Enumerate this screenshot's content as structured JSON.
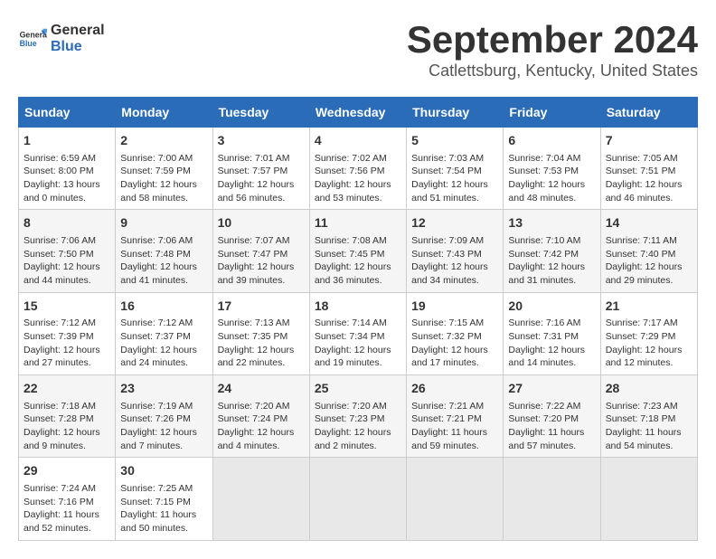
{
  "logo": {
    "text_line1": "General",
    "text_line2": "Blue"
  },
  "header": {
    "month_year": "September 2024",
    "location": "Catlettsburg, Kentucky, United States"
  },
  "calendar": {
    "headers": [
      "Sunday",
      "Monday",
      "Tuesday",
      "Wednesday",
      "Thursday",
      "Friday",
      "Saturday"
    ],
    "rows": [
      [
        {
          "day": "1",
          "info": "Sunrise: 6:59 AM\nSunset: 8:00 PM\nDaylight: 13 hours\nand 0 minutes."
        },
        {
          "day": "2",
          "info": "Sunrise: 7:00 AM\nSunset: 7:59 PM\nDaylight: 12 hours\nand 58 minutes."
        },
        {
          "day": "3",
          "info": "Sunrise: 7:01 AM\nSunset: 7:57 PM\nDaylight: 12 hours\nand 56 minutes."
        },
        {
          "day": "4",
          "info": "Sunrise: 7:02 AM\nSunset: 7:56 PM\nDaylight: 12 hours\nand 53 minutes."
        },
        {
          "day": "5",
          "info": "Sunrise: 7:03 AM\nSunset: 7:54 PM\nDaylight: 12 hours\nand 51 minutes."
        },
        {
          "day": "6",
          "info": "Sunrise: 7:04 AM\nSunset: 7:53 PM\nDaylight: 12 hours\nand 48 minutes."
        },
        {
          "day": "7",
          "info": "Sunrise: 7:05 AM\nSunset: 7:51 PM\nDaylight: 12 hours\nand 46 minutes."
        }
      ],
      [
        {
          "day": "8",
          "info": "Sunrise: 7:06 AM\nSunset: 7:50 PM\nDaylight: 12 hours\nand 44 minutes."
        },
        {
          "day": "9",
          "info": "Sunrise: 7:06 AM\nSunset: 7:48 PM\nDaylight: 12 hours\nand 41 minutes."
        },
        {
          "day": "10",
          "info": "Sunrise: 7:07 AM\nSunset: 7:47 PM\nDaylight: 12 hours\nand 39 minutes."
        },
        {
          "day": "11",
          "info": "Sunrise: 7:08 AM\nSunset: 7:45 PM\nDaylight: 12 hours\nand 36 minutes."
        },
        {
          "day": "12",
          "info": "Sunrise: 7:09 AM\nSunset: 7:43 PM\nDaylight: 12 hours\nand 34 minutes."
        },
        {
          "day": "13",
          "info": "Sunrise: 7:10 AM\nSunset: 7:42 PM\nDaylight: 12 hours\nand 31 minutes."
        },
        {
          "day": "14",
          "info": "Sunrise: 7:11 AM\nSunset: 7:40 PM\nDaylight: 12 hours\nand 29 minutes."
        }
      ],
      [
        {
          "day": "15",
          "info": "Sunrise: 7:12 AM\nSunset: 7:39 PM\nDaylight: 12 hours\nand 27 minutes."
        },
        {
          "day": "16",
          "info": "Sunrise: 7:12 AM\nSunset: 7:37 PM\nDaylight: 12 hours\nand 24 minutes."
        },
        {
          "day": "17",
          "info": "Sunrise: 7:13 AM\nSunset: 7:35 PM\nDaylight: 12 hours\nand 22 minutes."
        },
        {
          "day": "18",
          "info": "Sunrise: 7:14 AM\nSunset: 7:34 PM\nDaylight: 12 hours\nand 19 minutes."
        },
        {
          "day": "19",
          "info": "Sunrise: 7:15 AM\nSunset: 7:32 PM\nDaylight: 12 hours\nand 17 minutes."
        },
        {
          "day": "20",
          "info": "Sunrise: 7:16 AM\nSunset: 7:31 PM\nDaylight: 12 hours\nand 14 minutes."
        },
        {
          "day": "21",
          "info": "Sunrise: 7:17 AM\nSunset: 7:29 PM\nDaylight: 12 hours\nand 12 minutes."
        }
      ],
      [
        {
          "day": "22",
          "info": "Sunrise: 7:18 AM\nSunset: 7:28 PM\nDaylight: 12 hours\nand 9 minutes."
        },
        {
          "day": "23",
          "info": "Sunrise: 7:19 AM\nSunset: 7:26 PM\nDaylight: 12 hours\nand 7 minutes."
        },
        {
          "day": "24",
          "info": "Sunrise: 7:20 AM\nSunset: 7:24 PM\nDaylight: 12 hours\nand 4 minutes."
        },
        {
          "day": "25",
          "info": "Sunrise: 7:20 AM\nSunset: 7:23 PM\nDaylight: 12 hours\nand 2 minutes."
        },
        {
          "day": "26",
          "info": "Sunrise: 7:21 AM\nSunset: 7:21 PM\nDaylight: 11 hours\nand 59 minutes."
        },
        {
          "day": "27",
          "info": "Sunrise: 7:22 AM\nSunset: 7:20 PM\nDaylight: 11 hours\nand 57 minutes."
        },
        {
          "day": "28",
          "info": "Sunrise: 7:23 AM\nSunset: 7:18 PM\nDaylight: 11 hours\nand 54 minutes."
        }
      ],
      [
        {
          "day": "29",
          "info": "Sunrise: 7:24 AM\nSunset: 7:16 PM\nDaylight: 11 hours\nand 52 minutes."
        },
        {
          "day": "30",
          "info": "Sunrise: 7:25 AM\nSunset: 7:15 PM\nDaylight: 11 hours\nand 50 minutes."
        },
        {
          "day": "",
          "info": ""
        },
        {
          "day": "",
          "info": ""
        },
        {
          "day": "",
          "info": ""
        },
        {
          "day": "",
          "info": ""
        },
        {
          "day": "",
          "info": ""
        }
      ]
    ]
  }
}
